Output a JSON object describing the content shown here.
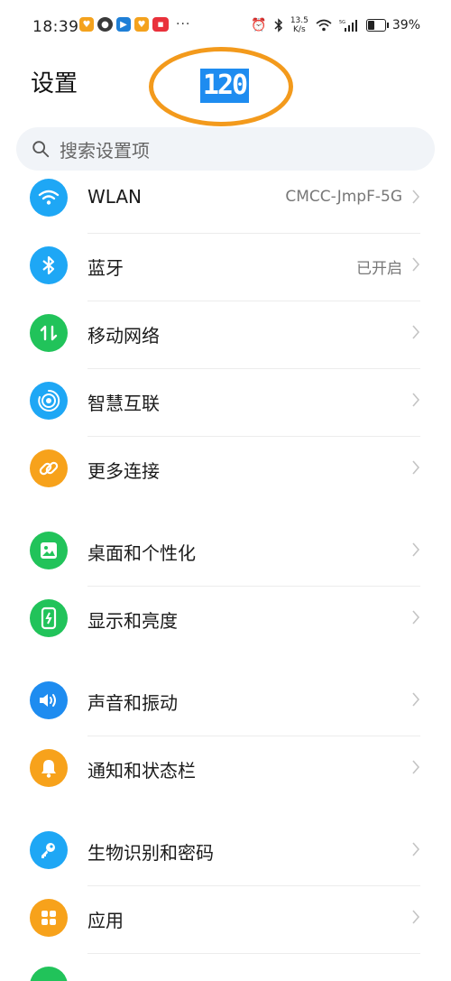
{
  "status_bar": {
    "time": "18:39",
    "net_speed_value": "13.5",
    "net_speed_unit": "K/s",
    "battery_percent": "39%"
  },
  "header": {
    "title": "设置",
    "annotation_badge": "120"
  },
  "search": {
    "placeholder": "搜索设置项"
  },
  "items": [
    {
      "label": "WLAN",
      "value": "CMCC-JmpF-5G",
      "icon": "wifi-icon",
      "color": "#1ea7f5"
    },
    {
      "label": "蓝牙",
      "value": "已开启",
      "icon": "bluetooth-icon",
      "color": "#1ea7f5"
    },
    {
      "label": "移动网络",
      "value": "",
      "icon": "mobile-data-icon",
      "color": "#21c35a"
    },
    {
      "label": "智慧互联",
      "value": "",
      "icon": "smart-connect-icon",
      "color": "#1ea7f5"
    },
    {
      "label": "更多连接",
      "value": "",
      "icon": "link-icon",
      "color": "#f7a21b"
    },
    {
      "label": "桌面和个性化",
      "value": "",
      "icon": "wallpaper-icon",
      "color": "#21c35a"
    },
    {
      "label": "显示和亮度",
      "value": "",
      "icon": "display-icon",
      "color": "#21c35a"
    },
    {
      "label": "声音和振动",
      "value": "",
      "icon": "sound-icon",
      "color": "#1e8cf0"
    },
    {
      "label": "通知和状态栏",
      "value": "",
      "icon": "bell-icon",
      "color": "#f7a21b"
    },
    {
      "label": "生物识别和密码",
      "value": "",
      "icon": "key-icon",
      "color": "#1ea7f5"
    },
    {
      "label": "应用",
      "value": "",
      "icon": "apps-icon",
      "color": "#f7a21b"
    }
  ]
}
